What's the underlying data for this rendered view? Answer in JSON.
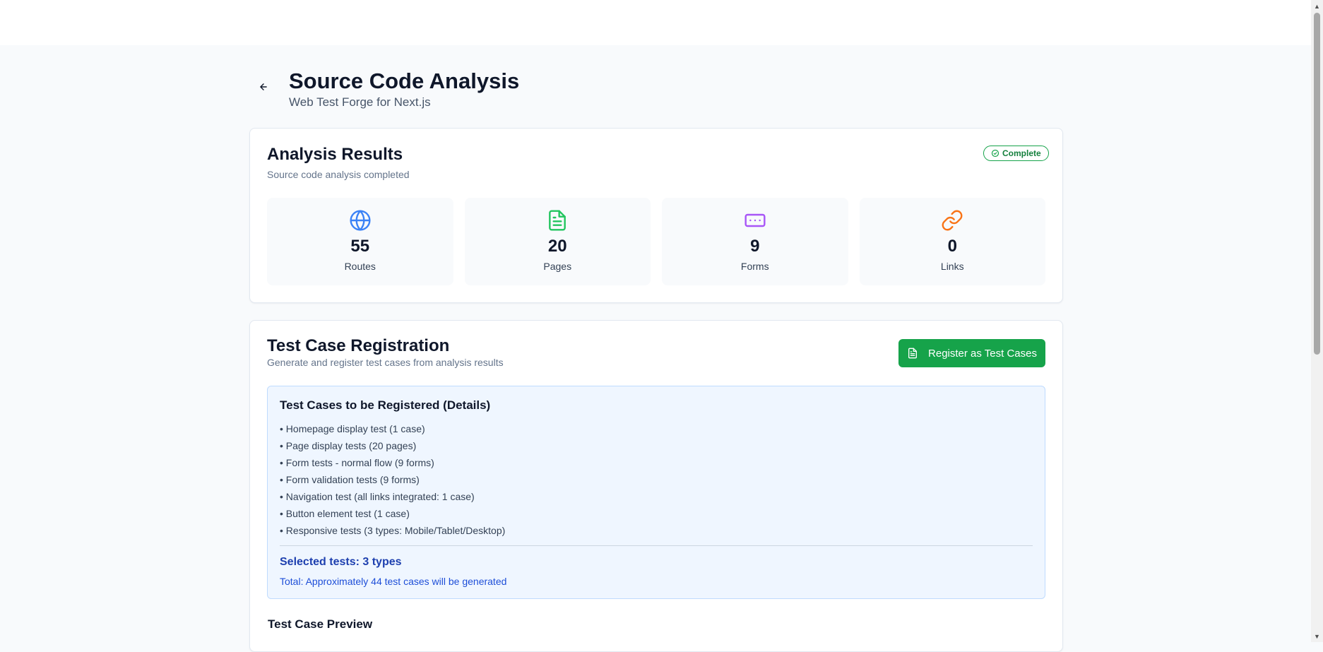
{
  "header": {
    "title": "Source Code Analysis",
    "subtitle": "Web Test Forge for Next.js"
  },
  "results": {
    "title": "Analysis Results",
    "description": "Source code analysis completed",
    "status": "Complete",
    "stats": [
      {
        "value": "55",
        "label": "Routes",
        "icon": "globe-icon",
        "color": "#3b82f6"
      },
      {
        "value": "20",
        "label": "Pages",
        "icon": "file-text-icon",
        "color": "#22c55e"
      },
      {
        "value": "9",
        "label": "Forms",
        "icon": "form-input-icon",
        "color": "#a855f7"
      },
      {
        "value": "0",
        "label": "Links",
        "icon": "link-icon",
        "color": "#f97316"
      }
    ]
  },
  "registration": {
    "title": "Test Case Registration",
    "description": "Generate and register test cases from analysis results",
    "button_label": "Register as Test Cases",
    "details": {
      "title": "Test Cases to be Registered (Details)",
      "items": [
        "• Homepage display test (1 case)",
        "• Page display tests (20 pages)",
        "• Form tests - normal flow (9 forms)",
        "• Form validation tests (9 forms)",
        "• Navigation test (all links integrated: 1 case)",
        "• Button element test (1 case)",
        "• Responsive tests (3 types: Mobile/Tablet/Desktop)"
      ],
      "selected": "Selected tests: 3 types",
      "total": "Total: Approximately 44 test cases will be generated"
    },
    "preview_title": "Test Case Preview"
  },
  "colors": {
    "accent_green": "#16a34a",
    "info_blue": "#1e40af"
  }
}
